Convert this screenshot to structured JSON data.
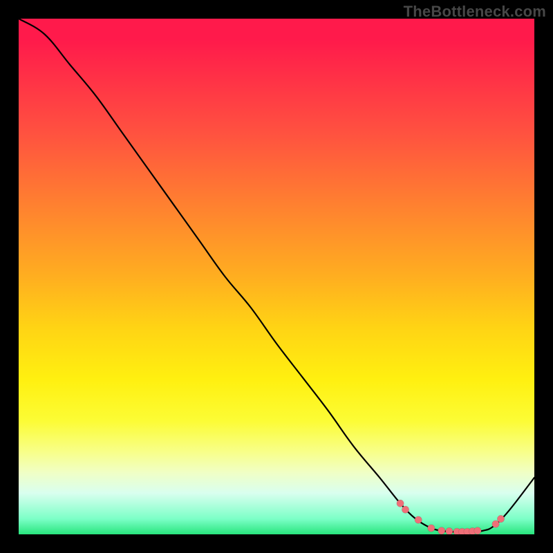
{
  "watermark": "TheBottleneck.com",
  "chart_data": {
    "type": "line",
    "title": "",
    "xlabel": "",
    "ylabel": "",
    "xlim": [
      0,
      100
    ],
    "ylim": [
      0,
      100
    ],
    "series": [
      {
        "name": "bottleneck-curve",
        "x": [
          0,
          5,
          10,
          15,
          20,
          25,
          30,
          35,
          40,
          45,
          50,
          55,
          60,
          65,
          70,
          74,
          77,
          80,
          82,
          84,
          86,
          88,
          90,
          92,
          95,
          100
        ],
        "y": [
          100,
          97,
          91,
          85,
          78,
          71,
          64,
          57,
          50,
          44,
          37,
          30.5,
          24,
          17,
          11,
          6,
          3,
          1.2,
          0.7,
          0.5,
          0.4,
          0.5,
          0.7,
          1.5,
          4.5,
          11
        ]
      }
    ],
    "markers": {
      "name": "highlight-dots",
      "x": [
        74,
        75,
        77.5,
        80,
        82,
        83.5,
        85,
        86,
        87,
        88,
        89,
        92.5,
        93.5
      ],
      "y": [
        6.0,
        4.8,
        2.8,
        1.2,
        0.7,
        0.6,
        0.5,
        0.5,
        0.5,
        0.6,
        0.7,
        2.0,
        3.0
      ]
    },
    "gradient_stops": [
      {
        "pos": 0,
        "color": "#ff1a4b"
      },
      {
        "pos": 22,
        "color": "#ff5140"
      },
      {
        "pos": 50,
        "color": "#ffae20"
      },
      {
        "pos": 70,
        "color": "#fff010"
      },
      {
        "pos": 88,
        "color": "#f0ffc5"
      },
      {
        "pos": 100,
        "color": "#28e57d"
      }
    ]
  }
}
